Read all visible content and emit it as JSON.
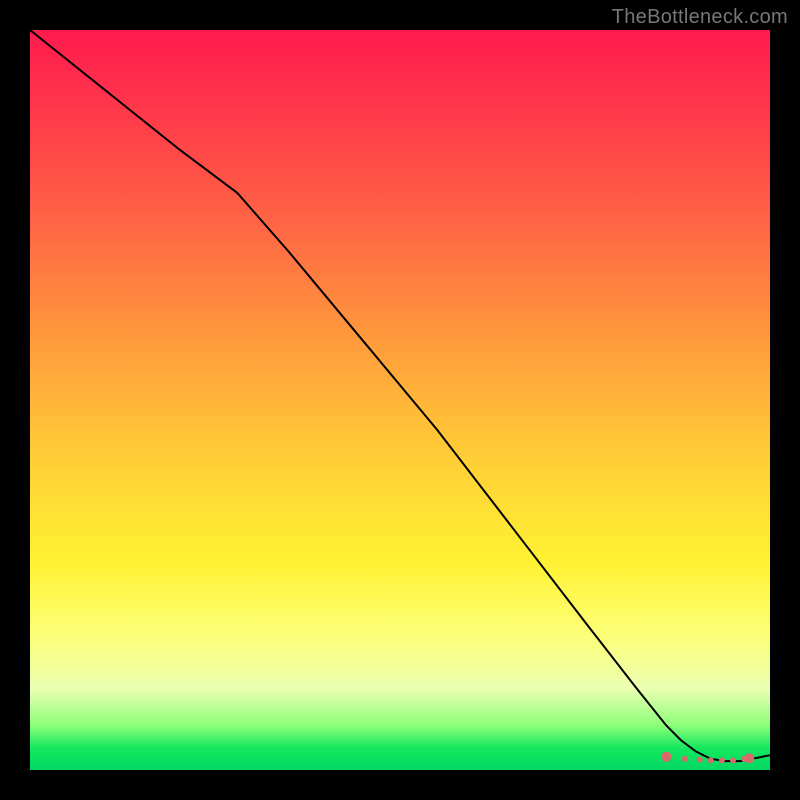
{
  "watermark": "TheBottleneck.com",
  "chart_data": {
    "type": "line",
    "title": "",
    "xlabel": "",
    "ylabel": "",
    "xlim": [
      0,
      100
    ],
    "ylim": [
      0,
      100
    ],
    "grid": false,
    "legend": false,
    "series": [
      {
        "name": "curve",
        "stroke": "#000000",
        "stroke_width": 2,
        "x": [
          0,
          10,
          20,
          28,
          35,
          45,
          55,
          65,
          75,
          82,
          86,
          88,
          90,
          92,
          94,
          96,
          97,
          100
        ],
        "values": [
          100,
          92,
          84,
          78,
          70,
          58,
          46,
          33,
          20,
          11,
          6,
          4,
          2.5,
          1.5,
          1.2,
          1.2,
          1.4,
          2.0
        ]
      }
    ],
    "markers": {
      "name": "near-zero-dots",
      "color": "#d96a6a",
      "radius_primary": 5,
      "radius_secondary": 3,
      "x": [
        86,
        88.5,
        90.5,
        92,
        93.5,
        95,
        96.5,
        97.2
      ],
      "values": [
        1.8,
        1.5,
        1.4,
        1.3,
        1.3,
        1.3,
        1.5,
        1.6
      ]
    }
  }
}
